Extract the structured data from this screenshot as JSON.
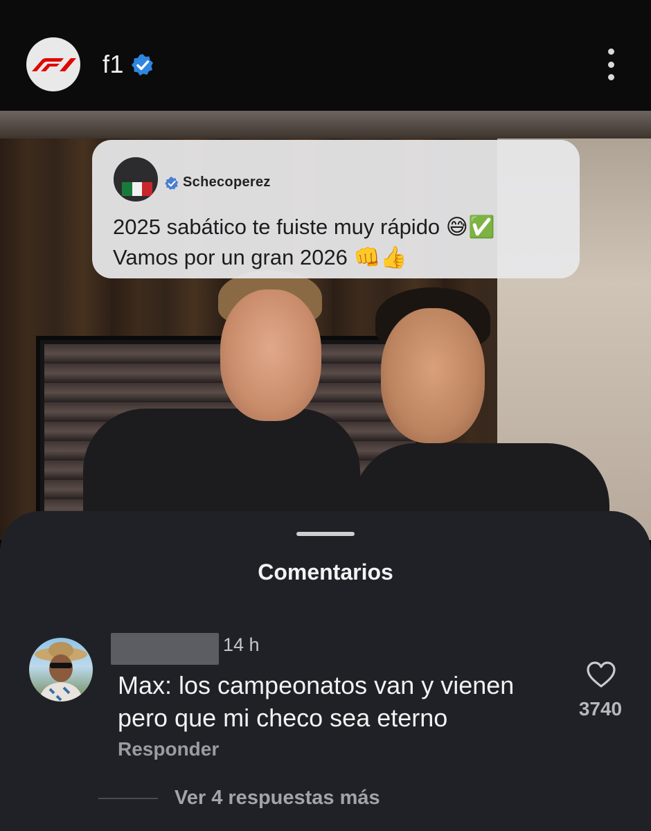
{
  "header": {
    "username": "f1",
    "verified_icon": "verified-badge-icon",
    "menu_icon": "more-vertical-icon",
    "brand_color": "#e10600"
  },
  "post": {
    "quote": {
      "author": "Schecoperez",
      "text_line1": "2025 sabático te fuiste muy rápido 😅✅",
      "text_line2": "Vamos por un gran 2026 👊👍"
    }
  },
  "comments": {
    "title": "Comentarios",
    "items": [
      {
        "time": "14 h",
        "text": "Max: los campeonatos van y vienen pero que mi checo sea eterno",
        "reply_label": "Responder",
        "likes": "3740"
      }
    ],
    "more_replies": "Ver 4 respuestas más"
  }
}
